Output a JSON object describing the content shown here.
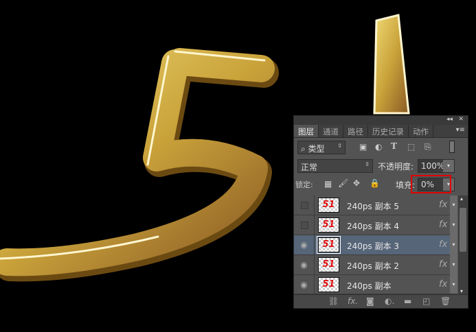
{
  "colors": {
    "panel": "#535353",
    "selected": "#566578",
    "highlight_box": "#e00000",
    "gold": "#d8b24a"
  },
  "tabs": [
    {
      "label": "图层",
      "active": true
    },
    {
      "label": "通道"
    },
    {
      "label": "路径"
    },
    {
      "label": "历史记录"
    },
    {
      "label": "动作"
    }
  ],
  "filter": {
    "label": "类型"
  },
  "blend_mode": "正常",
  "opacity": {
    "label": "不透明度:",
    "value": "100%"
  },
  "fill": {
    "label": "填充:",
    "value": "0%"
  },
  "lock_label": "锁定:",
  "layers": [
    {
      "name": "240ps 副本 5",
      "visible": false,
      "selected": false,
      "thumb": "51"
    },
    {
      "name": "240ps 副本 4",
      "visible": false,
      "selected": false,
      "thumb": "51"
    },
    {
      "name": "240ps 副本 3",
      "visible": true,
      "selected": true,
      "thumb": "51"
    },
    {
      "name": "240ps 副本 2",
      "visible": true,
      "selected": false,
      "thumb": "51"
    },
    {
      "name": "240ps 副本",
      "visible": true,
      "selected": false,
      "thumb": "51"
    }
  ],
  "fx_label": "fx",
  "artwork_text": "51"
}
